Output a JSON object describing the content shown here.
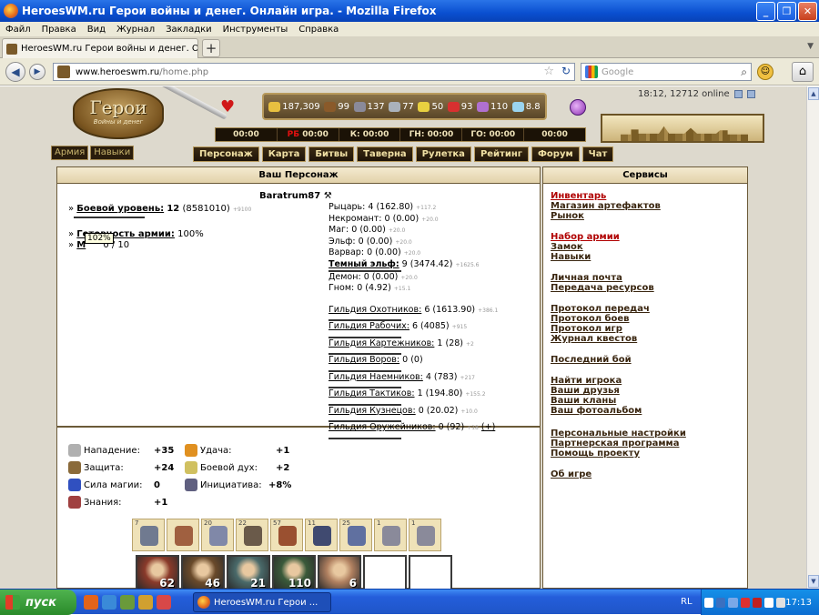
{
  "window": {
    "title": "HeroesWM.ru Герои войны и денег. Онлайн игра. - Mozilla Firefox"
  },
  "menu": [
    "Файл",
    "Правка",
    "Вид",
    "Журнал",
    "Закладки",
    "Инструменты",
    "Справка"
  ],
  "tab": {
    "title": "HeroesWM.ru Герои войны и денег. Онла...",
    "new_tab": "+"
  },
  "nav": {
    "url_host": "www.heroeswm.ru",
    "url_path": "/home.php",
    "search_placeholder": "Google"
  },
  "game": {
    "logo_title": "Герои",
    "logo_subtitle": "Войны и денег",
    "clock": "18:12, 12712 online",
    "resources": [
      {
        "name": "gold",
        "value": "187,309",
        "color": "#e8c040"
      },
      {
        "name": "wood",
        "value": "99",
        "color": "#8a5a2a"
      },
      {
        "name": "ore",
        "value": "137",
        "color": "#8a8a9a"
      },
      {
        "name": "mercury",
        "value": "77",
        "color": "#aab2bc"
      },
      {
        "name": "sulfur",
        "value": "50",
        "color": "#e8d040"
      },
      {
        "name": "crystal",
        "value": "93",
        "color": "#d83030"
      },
      {
        "name": "gems",
        "value": "110",
        "color": "#b070d0"
      },
      {
        "name": "diamonds",
        "value": "8.8",
        "color": "#9ad4f0"
      }
    ],
    "timers": [
      {
        "label": "",
        "time": "00:00",
        "red": ""
      },
      {
        "label": "",
        "time": "00:00",
        "red": "РБ"
      },
      {
        "label": "К:",
        "time": "00:00",
        "red": ""
      },
      {
        "label": "ГН:",
        "time": "00:00",
        "red": ""
      },
      {
        "label": "ГО:",
        "time": "00:00",
        "red": ""
      },
      {
        "label": "",
        "time": "00:00",
        "red": ""
      }
    ],
    "left_nav": [
      "Армия",
      "Навыки"
    ],
    "top_nav": [
      "Персонаж",
      "Карта",
      "Битвы",
      "Таверна",
      "Рулетка",
      "Рейтинг",
      "Форум",
      "Чат"
    ]
  },
  "char": {
    "panel_title": "Ваш Персонаж",
    "name": "Baratrum87",
    "level_label": "Боевой уровень:",
    "level": "12",
    "level_exp": "(8581010)",
    "level_next": "+9100",
    "army_ready_label": "Готовность армии:",
    "army_ready": "100%",
    "mana": "0 / 10",
    "tooltip": "102%",
    "factions": [
      {
        "name": "Рыцарь:",
        "val": "4 (162.80)",
        "next": "+117.2",
        "u": false
      },
      {
        "name": "Некромант:",
        "val": "0 (0.00)",
        "next": "+20.0",
        "u": false
      },
      {
        "name": "Маг:",
        "val": "0 (0.00)",
        "next": "+20.0",
        "u": false
      },
      {
        "name": "Эльф:",
        "val": "0 (0.00)",
        "next": "+20.0",
        "u": false
      },
      {
        "name": "Варвар:",
        "val": "0 (0.00)",
        "next": "+20.0",
        "u": false
      },
      {
        "name": "Темный эльф:",
        "val": "9 (3474.42)",
        "next": "+1625.6",
        "u": true
      },
      {
        "name": "Демон:",
        "val": "0 (0.00)",
        "next": "+20.0",
        "u": false
      },
      {
        "name": "Гном:",
        "val": "0 (4.92)",
        "next": "+15.1",
        "u": false
      }
    ],
    "guilds": [
      {
        "name": "Гильдия Охотников:",
        "val": "6 (1613.90)",
        "next": "+386.1"
      },
      {
        "name": "Гильдия Рабочих:",
        "val": "6 (4085)",
        "next": "+915"
      },
      {
        "name": "Гильдия Картежников:",
        "val": "1 (28)",
        "next": "+2"
      },
      {
        "name": "Гильдия Воров:",
        "val": "0 (0)",
        "next": ""
      },
      {
        "name": "Гильдия Наемников:",
        "val": "4 (783)",
        "next": "+217"
      },
      {
        "name": "Гильдия Тактиков:",
        "val": "1 (194.80)",
        "next": "+155.2"
      },
      {
        "name": "Гильдия Кузнецов:",
        "val": "0 (20.02)",
        "next": "+10.0"
      },
      {
        "name": "Гильдия Оружейников:",
        "val": "0 (92)",
        "next": "+18",
        "extra": "(+)"
      }
    ],
    "stats": [
      {
        "label": "Нападение:",
        "value": "+35",
        "icon": "sword-icon",
        "color": "#b0b0b0"
      },
      {
        "label": "Защита:",
        "value": "+24",
        "icon": "shield-icon",
        "color": "#8a6a3a"
      },
      {
        "label": "Сила магии:",
        "value": "0",
        "icon": "wand-icon",
        "color": "#3050c0"
      },
      {
        "label": "Знания:",
        "value": "+1",
        "icon": "book-icon",
        "color": "#a04040"
      },
      {
        "label": "Удача:",
        "value": "+1",
        "icon": "rainbow-icon",
        "color": "#e09020"
      },
      {
        "label": "Боевой дух:",
        "value": "+2",
        "icon": "wings-icon",
        "color": "#d0c060"
      },
      {
        "label": "Инициатива:",
        "value": "+8%",
        "icon": "hourglass-icon",
        "color": "#606080"
      }
    ],
    "artifacts": [
      {
        "n": "7",
        "color": "#707a90"
      },
      {
        "n": "",
        "color": "#a06040"
      },
      {
        "n": "20",
        "color": "#8088a8"
      },
      {
        "n": "22",
        "color": "#6a5a4a"
      },
      {
        "n": "57",
        "color": "#9a5030"
      },
      {
        "n": "11",
        "color": "#404a70"
      },
      {
        "n": "25",
        "color": "#6070a0"
      },
      {
        "n": "1",
        "color": "#8a8a9a"
      },
      {
        "n": "1",
        "color": "#8a8a9a"
      }
    ],
    "army": [
      {
        "count": "62",
        "color": "#8a3a2a"
      },
      {
        "count": "46",
        "color": "#6a4a2a"
      },
      {
        "count": "21",
        "color": "#4a6a6a"
      },
      {
        "count": "110",
        "color": "#3a5a3a"
      },
      {
        "count": "6",
        "color": "#b08060"
      },
      {
        "count": "",
        "color": "#ffffff"
      },
      {
        "count": "",
        "color": "#ffffff"
      }
    ]
  },
  "services": {
    "title": "Сервисы",
    "items": [
      {
        "label": "Инвентарь",
        "red": true,
        "top": 0
      },
      {
        "label": "Магазин артефактов",
        "red": false
      },
      {
        "label": "Рынок",
        "red": false
      },
      {
        "label": "Набор армии",
        "red": true
      },
      {
        "label": "Замок",
        "red": false
      },
      {
        "label": "Навыки",
        "red": false
      },
      {
        "label": "Личная почта",
        "red": false
      },
      {
        "label": "Передача ресурсов",
        "red": false
      },
      {
        "label": "Протокол передач",
        "red": false
      },
      {
        "label": "Протокол боев",
        "red": false
      },
      {
        "label": "Протокол игр",
        "red": false
      },
      {
        "label": "Журнал квестов",
        "red": false
      },
      {
        "label": "Последний бой",
        "red": false
      },
      {
        "label": "Найти игрока",
        "red": false
      },
      {
        "label": "Ваши друзья",
        "red": false
      },
      {
        "label": "Ваши кланы",
        "red": false
      },
      {
        "label": "Ваш фотоальбом",
        "red": false
      },
      {
        "label": "Персональные настройки",
        "red": false
      },
      {
        "label": "Партнерская программа",
        "red": false
      },
      {
        "label": "Помощь проекту",
        "red": false
      },
      {
        "label": "Об игре",
        "red": false
      }
    ]
  },
  "taskbar": {
    "start": "пуск",
    "task": "HeroesWM.ru Герои ...",
    "lang": "RL",
    "time": "17:13"
  }
}
